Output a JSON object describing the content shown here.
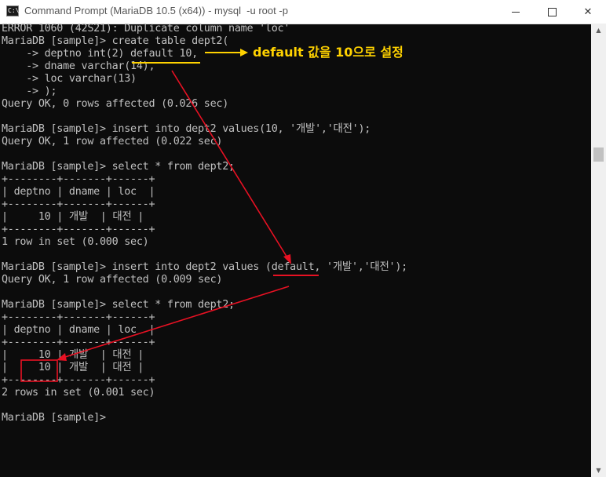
{
  "window": {
    "title": "Command Prompt (MariaDB 10.5 (x64)) - mysql  -u root -p",
    "app_icon_text": "C:\\",
    "minimize_icon": "minimize-icon",
    "maximize_icon": "maximize-icon",
    "close_icon": "close-icon",
    "close_glyph": "✕"
  },
  "console": {
    "lines": [
      "ERROR 1060 (42S21): Duplicate column name 'loc'",
      "MariaDB [sample]> create table dept2(",
      "    -> deptno int(2) default 10,",
      "    -> dname varchar(14),",
      "    -> loc varchar(13)",
      "    -> );",
      "Query OK, 0 rows affected (0.026 sec)",
      "",
      "MariaDB [sample]> insert into dept2 values(10, '개발','대전');",
      "Query OK, 1 row affected (0.022 sec)",
      "",
      "MariaDB [sample]> select * from dept2;",
      "+--------+-------+------+",
      "| deptno | dname | loc  |",
      "+--------+-------+------+",
      "|     10 | 개발  | 대전 |",
      "+--------+-------+------+",
      "1 row in set (0.000 sec)",
      "",
      "MariaDB [sample]> insert into dept2 values (default, '개발','대전');",
      "Query OK, 1 row affected (0.009 sec)",
      "",
      "MariaDB [sample]> select * from dept2;",
      "+--------+-------+------+",
      "| deptno | dname | loc  |",
      "+--------+-------+------+",
      "|     10 | 개발  | 대전 |",
      "|     10 | 개발  | 대전 |",
      "+--------+-------+------+",
      "2 rows in set (0.001 sec)",
      "",
      "MariaDB [sample]>"
    ]
  },
  "annotation": {
    "label": "default 값을 10으로 설정",
    "label_color": "#ffd200",
    "arrow_color": "#e81123"
  },
  "scrollbar": {
    "up_icon": "scroll-up-arrow-icon",
    "down_icon": "scroll-down-arrow-icon",
    "up_glyph": "▲",
    "down_glyph": "▼"
  }
}
